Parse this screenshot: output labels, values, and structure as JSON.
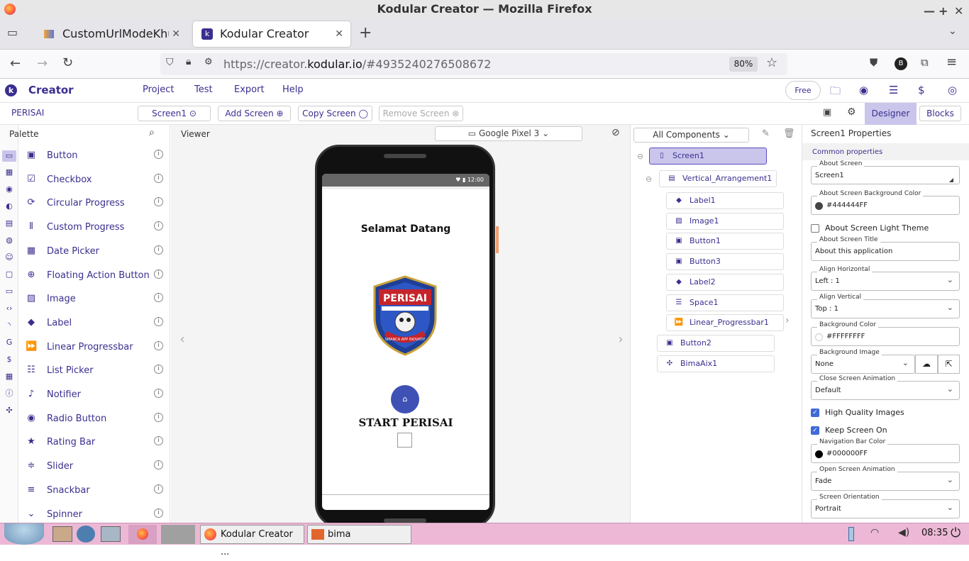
{
  "window": {
    "title": "Kodular Creator — Mozilla Firefox"
  },
  "browser": {
    "tabs": [
      {
        "label": "CustomUrlModeKhusus"
      },
      {
        "label": "Kodular Creator"
      }
    ],
    "url_prefix": "https://creator.",
    "url_domain": "kodular.io",
    "url_suffix": "/#4935240276508672",
    "zoom": "80%",
    "profile_initial": "B"
  },
  "app": {
    "brand": "Creator",
    "menu": [
      "Project",
      "Test",
      "Export",
      "Help"
    ],
    "plan": "Free",
    "project_name": "PERISAI",
    "screen_select": "Screen1",
    "add_screen": "Add Screen",
    "copy_screen": "Copy Screen",
    "remove_screen": "Remove Screen",
    "designer": "Designer",
    "blocks": "Blocks",
    "accent": "#3a2f8f"
  },
  "palette": {
    "title": "Palette",
    "items": [
      {
        "label": "Button",
        "icon": "button-icon"
      },
      {
        "label": "Checkbox",
        "icon": "checkbox-icon"
      },
      {
        "label": "Circular Progress",
        "icon": "circular-progress-icon"
      },
      {
        "label": "Custom Progress",
        "icon": "custom-progress-icon"
      },
      {
        "label": "Date Picker",
        "icon": "date-picker-icon"
      },
      {
        "label": "Floating Action Button",
        "icon": "fab-icon"
      },
      {
        "label": "Image",
        "icon": "image-icon"
      },
      {
        "label": "Label",
        "icon": "label-icon"
      },
      {
        "label": "Linear Progressbar",
        "icon": "linear-progress-icon"
      },
      {
        "label": "List Picker",
        "icon": "list-picker-icon"
      },
      {
        "label": "Notifier",
        "icon": "notifier-icon"
      },
      {
        "label": "Radio Button",
        "icon": "radio-button-icon"
      },
      {
        "label": "Rating Bar",
        "icon": "rating-bar-icon"
      },
      {
        "label": "Slider",
        "icon": "slider-icon"
      },
      {
        "label": "Snackbar",
        "icon": "snackbar-icon"
      },
      {
        "label": "Spinner",
        "icon": "spinner-icon"
      }
    ]
  },
  "viewer": {
    "title": "Viewer",
    "device": "Google Pixel 3",
    "status_time": "12:00",
    "app_title": "Selamat Datang",
    "logo_text": "PERISAI",
    "logo_subtext": "SMANCA APP INOVATIF",
    "start_label": "START PERISAI"
  },
  "components": {
    "filter": "All Components",
    "tree": [
      {
        "label": "Screen1",
        "icon": "phone-icon"
      },
      {
        "label": "Vertical_Arrangement1",
        "icon": "arrangement-icon"
      },
      {
        "label": "Label1",
        "icon": "label-icon"
      },
      {
        "label": "Image1",
        "icon": "image-icon"
      },
      {
        "label": "Button1",
        "icon": "button-icon"
      },
      {
        "label": "Button3",
        "icon": "button-icon"
      },
      {
        "label": "Label2",
        "icon": "label-icon"
      },
      {
        "label": "Space1",
        "icon": "space-icon"
      },
      {
        "label": "Linear_Progressbar1",
        "icon": "linear-progress-icon"
      },
      {
        "label": "Button2",
        "icon": "button-icon"
      },
      {
        "label": "BimaAix1",
        "icon": "extension-icon"
      }
    ]
  },
  "properties": {
    "title": "Screen1 Properties",
    "section": "Common properties",
    "about_screen": {
      "label": "About Screen",
      "value": "Screen1"
    },
    "bg_color_about": {
      "label": "About Screen Background Color",
      "value": "#444444FF",
      "swatch": "#444444"
    },
    "light_theme": {
      "label": "About Screen Light Theme"
    },
    "about_title": {
      "label": "About Screen Title",
      "value": "About this application"
    },
    "align_h": {
      "label": "Align Horizontal",
      "value": "Left : 1"
    },
    "align_v": {
      "label": "Align Vertical",
      "value": "Top : 1"
    },
    "bg_color": {
      "label": "Background Color",
      "value": "#FFFFFFFF",
      "swatch": "#ffffff"
    },
    "bg_image": {
      "label": "Background Image",
      "value": "None"
    },
    "close_anim": {
      "label": "Close Screen Animation",
      "value": "Default"
    },
    "high_quality": {
      "label": "High Quality Images"
    },
    "keep_on": {
      "label": "Keep Screen On"
    },
    "nav_color": {
      "label": "Navigation Bar Color",
      "value": "#000000FF",
      "swatch": "#000000"
    },
    "open_anim": {
      "label": "Open Screen Animation",
      "value": "Fade"
    },
    "orientation": {
      "label": "Screen Orientation",
      "value": "Portrait"
    }
  },
  "taskbar": {
    "items": [
      "Kodular Creator ...",
      "bima"
    ],
    "time": "08:35"
  }
}
